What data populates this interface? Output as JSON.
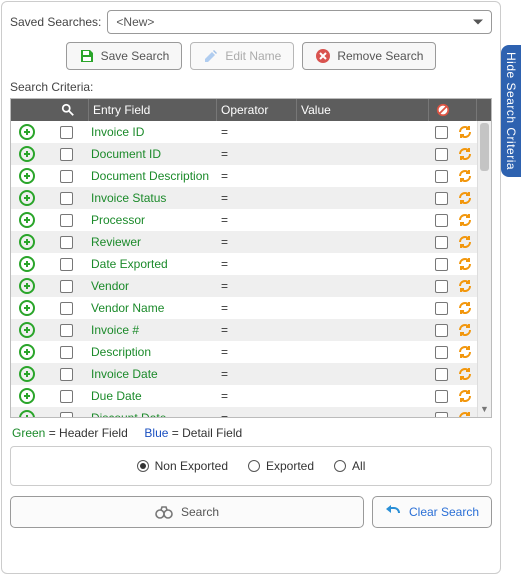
{
  "side_tab": "Hide Search Criteria",
  "saved_searches": {
    "label": "Saved Searches:",
    "selected": "<New>"
  },
  "buttons": {
    "save_search": "Save Search",
    "edit_name": "Edit Name",
    "remove_search": "Remove Search",
    "search": "Search",
    "clear_search": "Clear Search"
  },
  "sections": {
    "criteria_label": "Search Criteria:"
  },
  "grid": {
    "headers": {
      "entry_field": "Entry Field",
      "operator": "Operator",
      "value": "Value"
    },
    "rows": [
      {
        "field": "Invoice ID",
        "operator": "="
      },
      {
        "field": "Document ID",
        "operator": "="
      },
      {
        "field": "Document Description",
        "operator": "="
      },
      {
        "field": "Invoice Status",
        "operator": "="
      },
      {
        "field": "Processor",
        "operator": "="
      },
      {
        "field": "Reviewer",
        "operator": "="
      },
      {
        "field": "Date Exported",
        "operator": "="
      },
      {
        "field": "Vendor",
        "operator": "="
      },
      {
        "field": "Vendor Name",
        "operator": "="
      },
      {
        "field": "Invoice #",
        "operator": "="
      },
      {
        "field": "Description",
        "operator": "="
      },
      {
        "field": "Invoice Date",
        "operator": "="
      },
      {
        "field": "Due Date",
        "operator": "="
      },
      {
        "field": "Discount Date",
        "operator": "="
      }
    ]
  },
  "legend": {
    "green_label": "Green",
    "green_desc": " = Header Field",
    "blue_label": "Blue",
    "blue_desc": " = Detail Field"
  },
  "filters": {
    "non_exported": "Non Exported",
    "exported": "Exported",
    "all": "All",
    "selected": "non_exported"
  }
}
